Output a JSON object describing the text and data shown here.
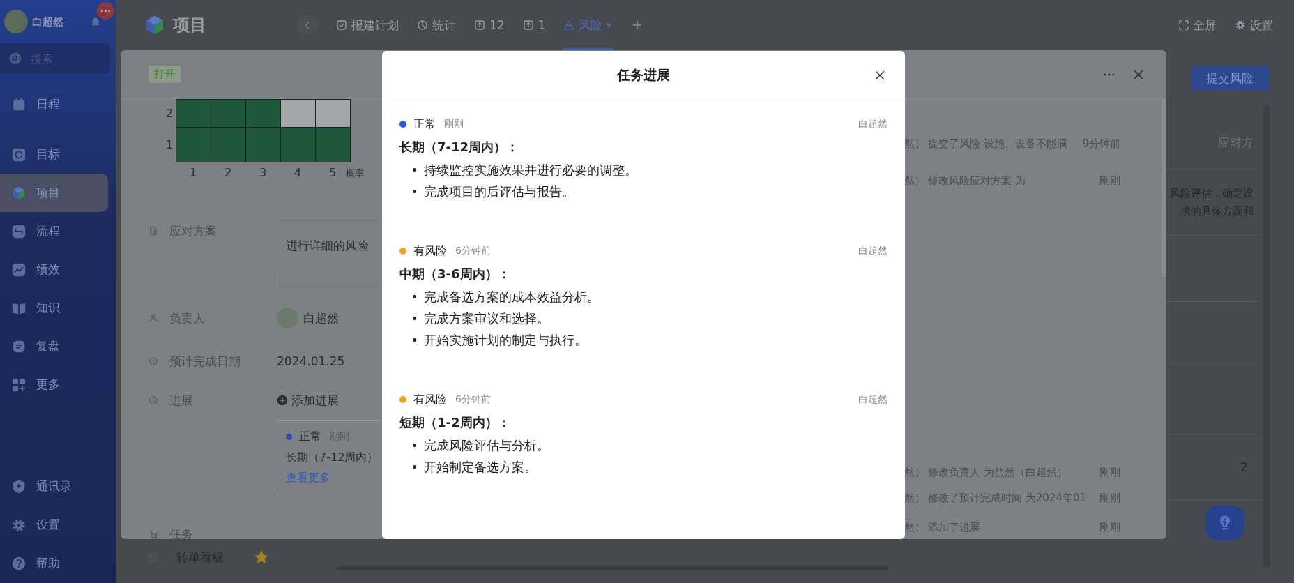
{
  "sidebar": {
    "user": {
      "name": "白超然"
    },
    "search": {
      "placeholder": "搜索"
    },
    "nav": [
      {
        "label": "日程",
        "selected": false
      },
      {
        "label": "目标",
        "selected": false
      },
      {
        "label": "项目",
        "selected": true
      },
      {
        "label": "流程",
        "selected": false
      },
      {
        "label": "绩效",
        "selected": false
      },
      {
        "label": "知识",
        "selected": false
      },
      {
        "label": "复盘",
        "selected": false
      },
      {
        "label": "更多",
        "selected": false
      }
    ],
    "bottom_nav": [
      {
        "label": "通讯录"
      },
      {
        "label": "设置"
      },
      {
        "label": "帮助"
      }
    ]
  },
  "header": {
    "title": "项目"
  },
  "tabs": [
    {
      "label": "报建计划",
      "selected": false
    },
    {
      "label": "统计",
      "selected": false
    },
    {
      "label": "12",
      "selected": false
    },
    {
      "label": "1",
      "selected": false
    },
    {
      "label": "风险",
      "selected": true
    }
  ],
  "toolbar": [
    {
      "label": "全屏"
    },
    {
      "label": "设置"
    }
  ],
  "page": {
    "side_list": [
      {
        "label": "转单看板",
        "starred": true
      }
    ],
    "submit_button": "提交风险",
    "table": {
      "column_header": "应对方",
      "rows": [
        {
          "kind": "response",
          "lines": [
            "风险评估，确定设",
            "求的具体方面和"
          ]
        },
        {
          "kind": "blank"
        },
        {
          "kind": "blank"
        },
        {
          "kind": "blank"
        },
        {
          "kind": "count",
          "value": "2"
        },
        {
          "kind": "blank"
        }
      ]
    }
  },
  "drawer": {
    "status_tag": "打开",
    "risk_matrix": {
      "rows": [
        {
          "label": "2",
          "cells": [
            {
              "highlighted": true
            },
            {
              "highlighted": true
            },
            {
              "highlighted": true
            },
            {
              "highlighted": false
            },
            {
              "highlighted": false
            }
          ]
        },
        {
          "label": "1",
          "cells": [
            {
              "highlighted": true
            },
            {
              "highlighted": true
            },
            {
              "highlighted": true
            },
            {
              "highlighted": true
            },
            {
              "highlighted": true
            }
          ]
        }
      ],
      "column_labels": [
        "1",
        "2",
        "3",
        "4",
        "5"
      ],
      "axis_label": "概率"
    },
    "fields": [
      {
        "kind": "textarea",
        "label": "应对方案",
        "value": "进行详细的风险"
      },
      {
        "kind": "person",
        "label": "负责人",
        "value": "白超然"
      },
      {
        "kind": "date",
        "label": "预计完成日期",
        "value": "2024.01.25"
      },
      {
        "kind": "progress",
        "label": "进展",
        "action": "添加进展",
        "card": {
          "status": "正常",
          "color": "#2a4db4",
          "time": "刚刚",
          "summary": "长期（7-12周内）",
          "link": "查看更多"
        }
      },
      {
        "kind": "section",
        "label": "任务"
      }
    ],
    "activity": [
      {
        "actor": "然）",
        "action": "提交了风险 设施、设备不能满",
        "time": "9分钟前"
      },
      {
        "actor": "然）",
        "action": "修改风险应对方案 为",
        "time": "刚刚"
      },
      {
        "actor": "然）",
        "action": "修改负责人 为盐然（白超然）",
        "time": "刚刚"
      },
      {
        "actor": "然）",
        "action": "修改了预计完成时间 为2024年01",
        "time": "刚刚"
      },
      {
        "actor": "然）",
        "action": "添加了进展",
        "time": "刚刚"
      }
    ]
  },
  "modal": {
    "title": "任务进展",
    "entries": [
      {
        "status": "正常",
        "color": "#1a5cff",
        "time": "刚刚",
        "author": "白超然",
        "heading": "长期（7-12周内）：",
        "items": [
          "持续监控实施效果并进行必要的调整。",
          "完成项目的后评估与报告。"
        ]
      },
      {
        "status": "有风险",
        "color": "#f5a01a",
        "time": "6分钟前",
        "author": "白超然",
        "heading": "中期（3-6周内）：",
        "items": [
          "完成备选方案的成本效益分析。",
          "完成方案审议和选择。",
          "开始实施计划的制定与执行。"
        ]
      },
      {
        "status": "有风险",
        "color": "#f5a01a",
        "time": "6分钟前",
        "author": "白超然",
        "heading": "短期（1-2周内）：",
        "items": [
          "完成风险评估与分析。",
          "开始制定备选方案。"
        ]
      }
    ]
  }
}
